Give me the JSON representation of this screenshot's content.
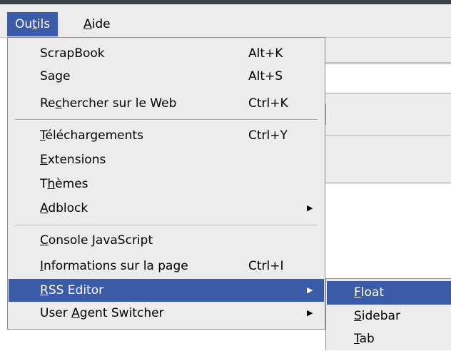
{
  "colors": {
    "highlight": "#3b5aa8",
    "menu_bg": "#ececec",
    "title_bar": "#3a3f4a"
  },
  "menubar": {
    "items": [
      {
        "pre": "Ou",
        "accel": "t",
        "post": "ils",
        "active": true
      },
      {
        "pre": "",
        "accel": "A",
        "post": "ide",
        "active": false
      }
    ]
  },
  "dropdown": {
    "items": [
      {
        "pre": "ScrapBook",
        "accel": "",
        "post": "",
        "shortcut": "Alt+K"
      },
      {
        "pre": "Sage",
        "accel": "",
        "post": "",
        "shortcut": "Alt+S"
      },
      {
        "pre": "Re",
        "accel": "c",
        "post": "hercher sur le Web",
        "shortcut": "Ctrl+K"
      },
      {
        "pre": "",
        "accel": "T",
        "post": "éléchargements",
        "shortcut": "Ctrl+Y"
      },
      {
        "pre": "",
        "accel": "E",
        "post": "xtensions",
        "shortcut": ""
      },
      {
        "pre": "T",
        "accel": "h",
        "post": "èmes",
        "shortcut": ""
      },
      {
        "pre": "",
        "accel": "A",
        "post": "dblock",
        "shortcut": "",
        "submenu_arrow": "arrow-right-icon"
      },
      {
        "pre": "",
        "accel": "C",
        "post": "onsole JavaScript",
        "shortcut": ""
      },
      {
        "pre": "",
        "accel": "I",
        "post": "nformations sur la page",
        "shortcut": "Ctrl+I"
      },
      {
        "pre": "",
        "accel": "R",
        "post": "SS Editor",
        "shortcut": "",
        "submenu_arrow": "arrow-right-icon",
        "active": true
      },
      {
        "pre": "User ",
        "accel": "A",
        "post": "gent Switcher",
        "shortcut": "",
        "submenu_arrow": "arrow-right-icon"
      }
    ]
  },
  "submenu": {
    "items": [
      {
        "pre": "",
        "accel": "F",
        "post": "loat",
        "active": true
      },
      {
        "pre": "",
        "accel": "S",
        "post": "idebar",
        "active": false
      },
      {
        "pre": "",
        "accel": "T",
        "post": "ab",
        "active": false
      }
    ]
  }
}
